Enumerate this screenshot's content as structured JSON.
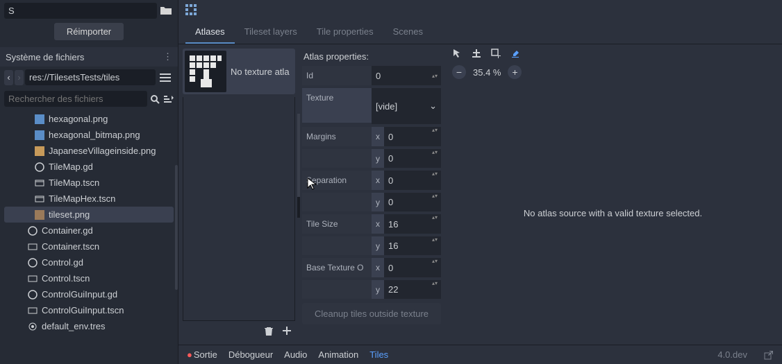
{
  "reimport": {
    "input_value": "S",
    "button": "Réimporter"
  },
  "fs": {
    "title": "Système de fichiers",
    "breadcrumb": "res://TilesetsTests/tiles",
    "search_placeholder": "Rechercher des fichiers",
    "files": [
      {
        "name": "hexagonal.png",
        "icon": "image"
      },
      {
        "name": "hexagonal_bitmap.png",
        "icon": "image"
      },
      {
        "name": "JapaneseVillageinside.png",
        "icon": "image"
      },
      {
        "name": "TileMap.gd",
        "icon": "script"
      },
      {
        "name": "TileMap.tscn",
        "icon": "scene"
      },
      {
        "name": "TileMapHex.tscn",
        "icon": "scene"
      },
      {
        "name": "tileset.png",
        "icon": "image",
        "selected": true
      }
    ],
    "files_root": [
      {
        "name": "Container.gd",
        "icon": "script"
      },
      {
        "name": "Container.tscn",
        "icon": "scene"
      },
      {
        "name": "Control.gd",
        "icon": "script"
      },
      {
        "name": "Control.tscn",
        "icon": "scene"
      },
      {
        "name": "ControlGuiInput.gd",
        "icon": "script"
      },
      {
        "name": "ControlGuiInput.tscn",
        "icon": "scene"
      },
      {
        "name": "default_env.tres",
        "icon": "resource"
      }
    ]
  },
  "tabs": {
    "items": [
      "Atlases",
      "Tileset layers",
      "Tile properties",
      "Scenes"
    ],
    "active": 0
  },
  "atlas_list": {
    "item_label": "No texture atla"
  },
  "properties": {
    "header": "Atlas properties:",
    "id": {
      "label": "Id",
      "value": "0"
    },
    "texture": {
      "label": "Texture",
      "value": "[vide]"
    },
    "margins": {
      "label": "Margins",
      "x": "0",
      "y": "0"
    },
    "separation": {
      "label": "Separation",
      "x": "0",
      "y": "0"
    },
    "tile_size": {
      "label": "Tile Size",
      "x": "16",
      "y": "16"
    },
    "base_offset": {
      "label": "Base Texture O",
      "x": "0",
      "y": "22"
    },
    "cleanup": "Cleanup tiles outside texture"
  },
  "viewport": {
    "zoom": "35.4 %",
    "placeholder": "No atlas source with a valid texture selected."
  },
  "bottom": {
    "tabs": [
      "Sortie",
      "Débogueur",
      "Audio",
      "Animation",
      "Tiles"
    ],
    "active": 4,
    "version": "4.0.dev"
  }
}
